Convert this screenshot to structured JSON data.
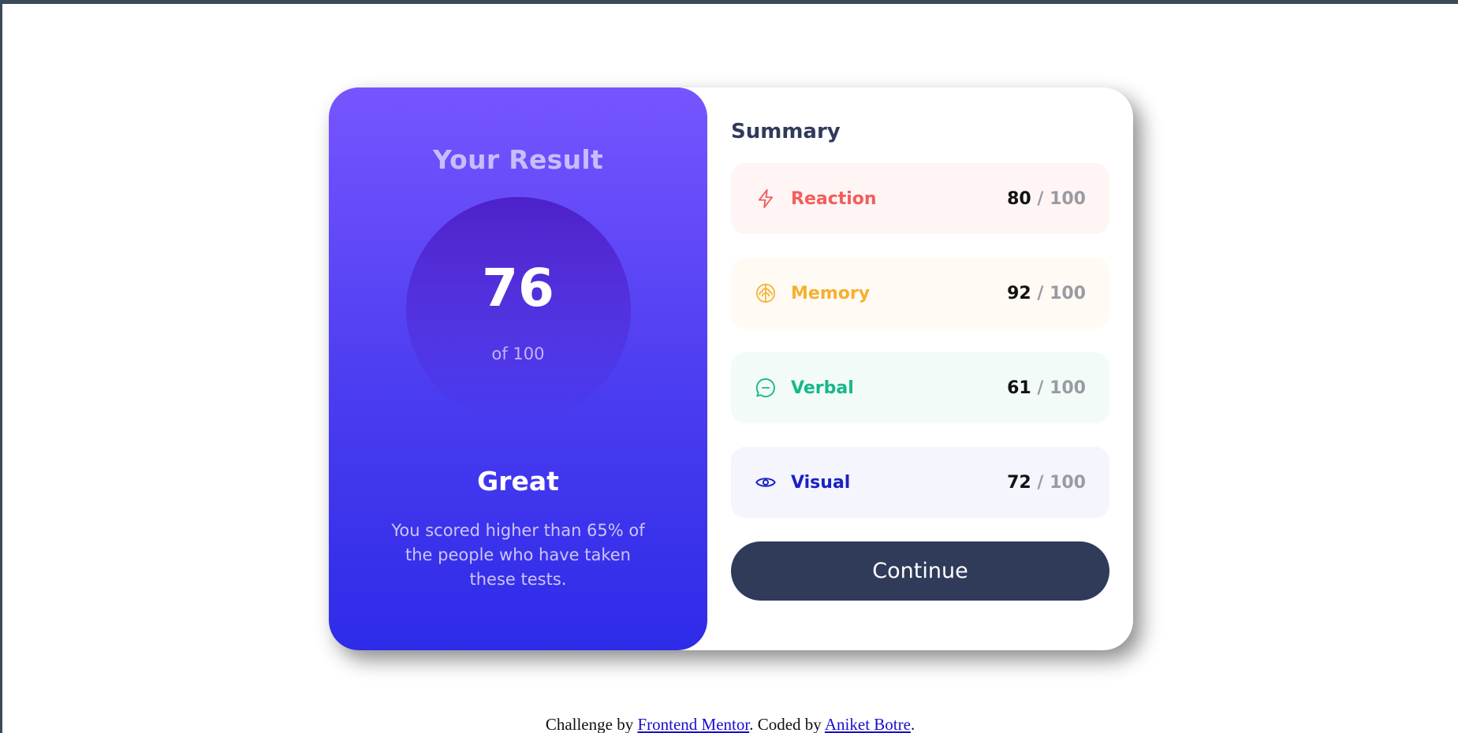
{
  "result": {
    "title": "Your Result",
    "score": "76",
    "total": "of 100",
    "grade": "Great",
    "description": "You scored higher than 65% of the people who have taken these tests."
  },
  "summary": {
    "title": "Summary",
    "items": [
      {
        "label": "Reaction",
        "score": "80",
        "separator": "/",
        "max": "100",
        "icon": "lightning-icon",
        "color": "#f55c5c",
        "bg": "#fff5f5"
      },
      {
        "label": "Memory",
        "score": "92",
        "separator": "/",
        "max": "100",
        "icon": "brain-icon",
        "color": "#f5b031",
        "bg": "#fffaf3"
      },
      {
        "label": "Verbal",
        "score": "61",
        "separator": "/",
        "max": "100",
        "icon": "chat-bubble-icon",
        "color": "#17b889",
        "bg": "#f2fbf8"
      },
      {
        "label": "Visual",
        "score": "72",
        "separator": "/",
        "max": "100",
        "icon": "eye-icon",
        "color": "#1a21c4",
        "bg": "#f4f5fd"
      }
    ],
    "continue_label": "Continue"
  },
  "footer": {
    "prefix": "Challenge by ",
    "link1": "Frontend Mentor",
    "middle": ". Coded by ",
    "link2": "Aniket Botre",
    "suffix": "."
  },
  "colors": {
    "accent": "#303b5a",
    "gradient_top": "#7755ff",
    "gradient_bottom": "#2e2be8"
  }
}
